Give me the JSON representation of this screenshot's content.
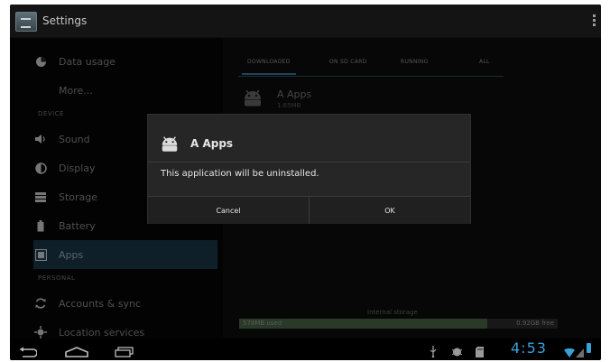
{
  "actionbar": {
    "title": "Settings"
  },
  "sidebar": {
    "items": [
      {
        "label": "Data usage",
        "icon": "pie-chart-icon"
      },
      {
        "label": "More...",
        "icon": ""
      },
      {
        "section": "DEVICE"
      },
      {
        "label": "Sound",
        "icon": "speaker-icon"
      },
      {
        "label": "Display",
        "icon": "brightness-icon"
      },
      {
        "label": "Storage",
        "icon": "storage-icon"
      },
      {
        "label": "Battery",
        "icon": "battery-icon"
      },
      {
        "label": "Apps",
        "icon": "apps-icon",
        "selected": true
      },
      {
        "section": "PERSONAL"
      },
      {
        "label": "Accounts & sync",
        "icon": "sync-icon"
      },
      {
        "label": "Location services",
        "icon": "location-icon"
      }
    ]
  },
  "content": {
    "tabs": [
      "DOWNLOADED",
      "ON SD CARD",
      "RUNNING",
      "ALL"
    ],
    "app_name": "A Apps",
    "app_size": "1.65MB",
    "storage": {
      "label": "Internal storage",
      "used": "578MB used",
      "free": "0.92GB free",
      "used_fraction": 0.78
    }
  },
  "dialog": {
    "title": "A Apps",
    "message": "This application will be uninstalled.",
    "cancel_label": "Cancel",
    "ok_label": "OK"
  },
  "statusbar": {
    "time": "4:53"
  },
  "colors": {
    "accent": "#3aa0d8",
    "selected_bg": "#1c3a4e",
    "storage_used": "#4b6c49"
  }
}
